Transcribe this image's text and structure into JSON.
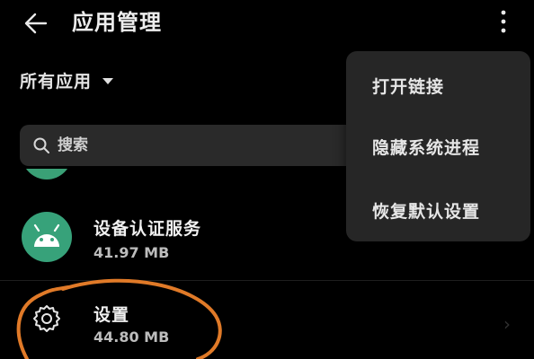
{
  "header": {
    "title": "应用管理",
    "back_icon": "arrow-left-icon",
    "more_icon": "more-vertical-icon"
  },
  "filter": {
    "label": "所有应用",
    "icon": "caret-down-icon"
  },
  "search": {
    "placeholder": "搜索",
    "icon": "search-icon"
  },
  "apps": [
    {
      "name": "设备认证服务",
      "size": "41.97 MB",
      "icon": "android-icon",
      "icon_color": "#37a27a"
    },
    {
      "name": "设置",
      "size": "44.80 MB",
      "icon": "gear-icon"
    }
  ],
  "menu": {
    "items": [
      {
        "label": "打开链接"
      },
      {
        "label": "隐藏系统进程"
      },
      {
        "label": "恢复默认设置"
      }
    ]
  },
  "colors": {
    "background": "#000000",
    "popup": "#262626",
    "search_field": "#2a2a2a",
    "annotation_circle": "#e07a28"
  }
}
